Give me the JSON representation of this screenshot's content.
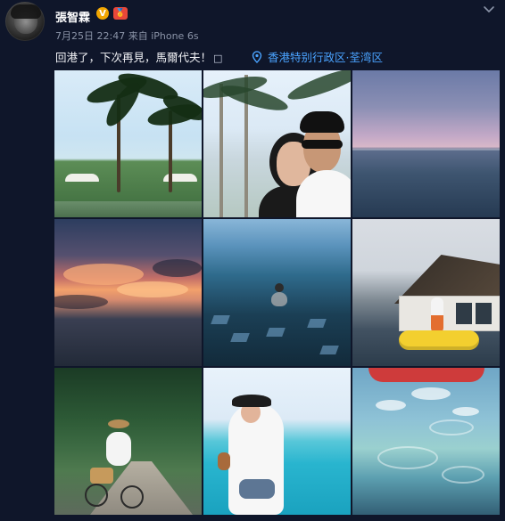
{
  "post": {
    "author": "張智霖",
    "badges": [
      "V",
      "🏅"
    ],
    "timestamp": "7月25日 22:47",
    "source": "来自 iPhone 6s",
    "text": "回港了，下次再見，馬爾代夫！",
    "trailing_icon": "□",
    "location": "香港特别行政区·荃湾区"
  },
  "ui": {
    "chevron_icon": "chevron-down-icon",
    "location_icon": "location-pin-icon",
    "avatar_icon": "avatar"
  },
  "photos": [
    {
      "name": "resort-palms-photo"
    },
    {
      "name": "couple-selfie-palms-photo"
    },
    {
      "name": "calm-sea-dusk-photo"
    },
    {
      "name": "sunset-clouds-photo"
    },
    {
      "name": "infinity-pool-swimmer-photo"
    },
    {
      "name": "villa-yellow-float-photo"
    },
    {
      "name": "bicycle-jungle-path-photo"
    },
    {
      "name": "beach-visor-woman-photo"
    },
    {
      "name": "aerial-reef-wing-photo"
    }
  ],
  "colors": {
    "background": "#0f162a",
    "accent_blue": "#4aa3ff",
    "meta_gray": "#8b94a8",
    "text_white": "#f1f2f6",
    "verified_orange": "#f2a600",
    "medal_red": "#e8473a"
  }
}
